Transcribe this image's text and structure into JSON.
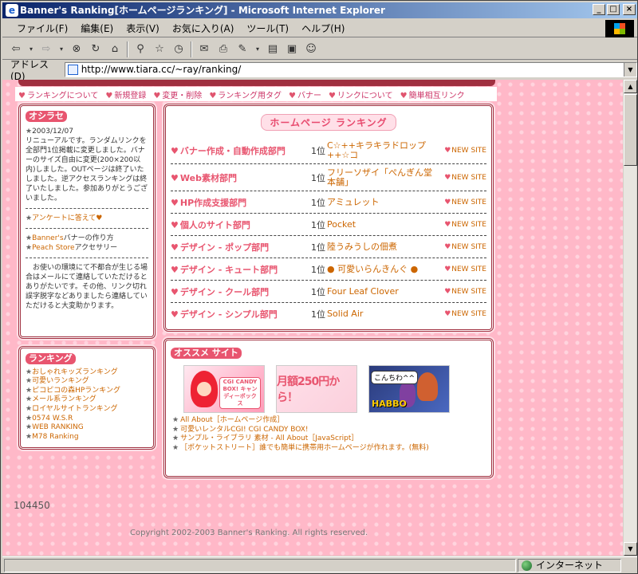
{
  "window": {
    "title": "Banner's Ranking[ホームページランキング] - Microsoft Internet Explorer",
    "buttons": {
      "minimize": "_",
      "maximize": "□",
      "close": "×"
    }
  },
  "menu": [
    "ファイル(F)",
    "編集(E)",
    "表示(V)",
    "お気に入り(A)",
    "ツール(T)",
    "ヘルプ(H)"
  ],
  "address": {
    "label": "アドレス(D)",
    "url": "http://www.tiara.cc/~ray/ranking/"
  },
  "status": {
    "zone": "インターネット"
  },
  "nav": [
    "ランキングについて",
    "新規登録",
    "変更・削除",
    "ランキング用タグ",
    "バナー",
    "リンクについて",
    "簡単相互リンク"
  ],
  "info": {
    "title": "オシラセ",
    "date": "2003/12/07",
    "body": "リニューアルです。ランダムリンクを全部門1位掲載に変更しました。バナーのサイズ自由に変更(200×200以内)しました。OUTページは終了いたしました。逆アクセスランキングは終了いたしました。参加ありがとうございました。",
    "survey_link": "アンケートに答えて♥",
    "links": [
      {
        "prefix": "Banner's",
        "text": "バナーの作り方"
      },
      {
        "prefix": "Peach Store",
        "text": "アクセサリー"
      }
    ],
    "note": "　お使いの環境にて不都合が生じる場合はメールにて連絡していただけるとありがたいです。その他、リンク切れ誤字脱字などありましたら連絡していただけると大変助かります。"
  },
  "rankings_panel": {
    "title": "ランキング",
    "items": [
      "おしゃれキッズランキング",
      "可愛いランキング",
      "ピコピコの森HPランキング",
      "メール系ランキング",
      "ロイヤルサイトランキング",
      "0574 W.S.R",
      "WEB RANKING",
      "M78 Ranking"
    ]
  },
  "main": {
    "title": "ホームページ ランキング",
    "new_label": "NEW SITE",
    "rows": [
      {
        "category": "バナー作成・自動作成部門",
        "rank": "1位",
        "site": "C☆++キラキラドロップ++☆コ",
        "tall": true
      },
      {
        "category": "Web素材部門",
        "rank": "1位",
        "site": "フリーソザイ「ぺんぎん堂本舗」",
        "tall": true
      },
      {
        "category": "HP作成支援部門",
        "rank": "1位",
        "site": "アミュレット",
        "tall": false
      },
      {
        "category": "個人のサイト部門",
        "rank": "1位",
        "site": "Pocket",
        "tall": false
      },
      {
        "category": "デザイン - ポップ部門",
        "rank": "1位",
        "site": "陸うみうしの佃煮",
        "tall": false
      },
      {
        "category": "デザイン - キュート部門",
        "rank": "1位",
        "site": "● 可愛いらんきんぐ ●",
        "tall": false
      },
      {
        "category": "デザイン - クール部門",
        "rank": "1位",
        "site": "Four Leaf Clover",
        "tall": false
      },
      {
        "category": "デザイン - シンプル部門",
        "rank": "1位",
        "site": "Solid Air",
        "tall": false
      }
    ]
  },
  "recommend": {
    "title": "オススメ サイト",
    "banners": {
      "b1_badge": "CGI CANDY BOX! キャンディーボックス",
      "b2_text": "月額250円から！",
      "b3_bubble": "こんちわ^^",
      "b3_logo": "HABBO"
    },
    "links": [
      "All About［ホームページ作成］",
      "可愛いレンタルCGI!  CGI CANDY BOX!",
      "サンプル・ライブラリ 素材  -  All About［JavaScript］",
      "［ポケットストリート］誰でも簡単に携帯用ホームページが作れます。(無料)"
    ]
  },
  "counter": "104450",
  "copyright": "Copyright 2002-2003 Banner's Ranking. All rights reserved."
}
